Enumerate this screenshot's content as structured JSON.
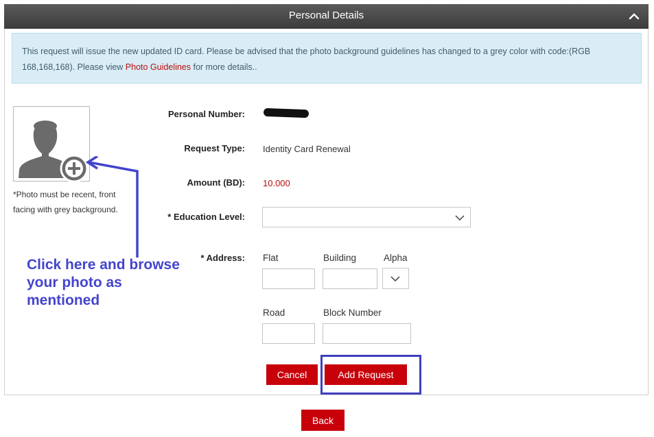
{
  "header": {
    "title": "Personal Details"
  },
  "notice": {
    "text_before_link": "This request will issue the new updated ID card. Please be advised that the photo background guidelines has changed to a grey color with code:(RGB 168,168,168). Please view ",
    "link_text": "Photo Guidelines",
    "text_after_link": " for more details.."
  },
  "photo": {
    "note": "*Photo must be recent, front facing with grey background."
  },
  "details": {
    "personal_number_label": "Personal Number:",
    "request_type_label": "Request Type:",
    "request_type_value": "Identity Card Renewal",
    "amount_label": "Amount (BD):",
    "amount_value": "10.000",
    "education_label": "* Education Level:",
    "education_value": ""
  },
  "address": {
    "label": "* Address:",
    "flat_label": "Flat",
    "building_label": "Building",
    "alpha_label": "Alpha",
    "road_label": "Road",
    "block_label": "Block Number",
    "flat_value": "",
    "building_value": "",
    "road_value": "",
    "block_value": ""
  },
  "buttons": {
    "cancel": "Cancel",
    "add_request": "Add Request",
    "back": "Back"
  },
  "annotation": {
    "text": "Click here and browse your photo as mentioned"
  },
  "colors": {
    "accent_red": "#c8000a",
    "annotation_blue": "#4444cc",
    "header_dark": "#444444",
    "notice_bg": "#daedf6"
  }
}
